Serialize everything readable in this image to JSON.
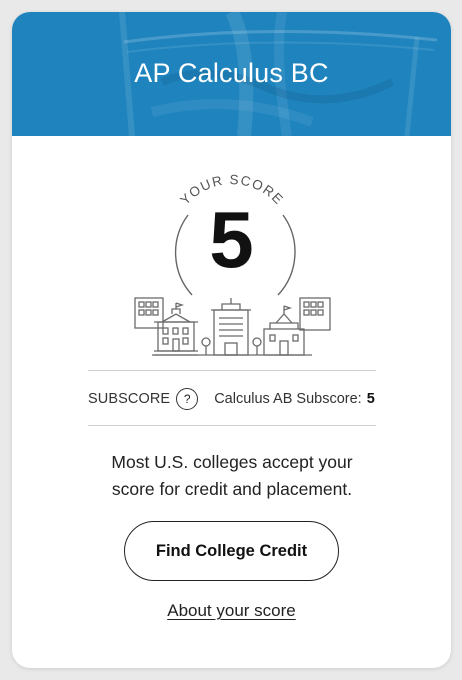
{
  "course": {
    "title": "AP Calculus BC"
  },
  "score": {
    "caption": "YOUR SCORE",
    "value": "5"
  },
  "subscore": {
    "label": "SUBSCORE",
    "help_symbol": "?",
    "ab_label": "Calculus AB Subscore:",
    "ab_value": "5"
  },
  "message": {
    "line1": "Most U.S. colleges accept your",
    "line2": "score for credit and placement."
  },
  "actions": {
    "find_credit_label": "Find College Credit",
    "about_link": "About your score"
  },
  "colors": {
    "header_blue": "#1f84be",
    "text_dark": "#111111"
  },
  "icons": {
    "illustration": "campus-buildings-icon",
    "help": "question-icon"
  }
}
